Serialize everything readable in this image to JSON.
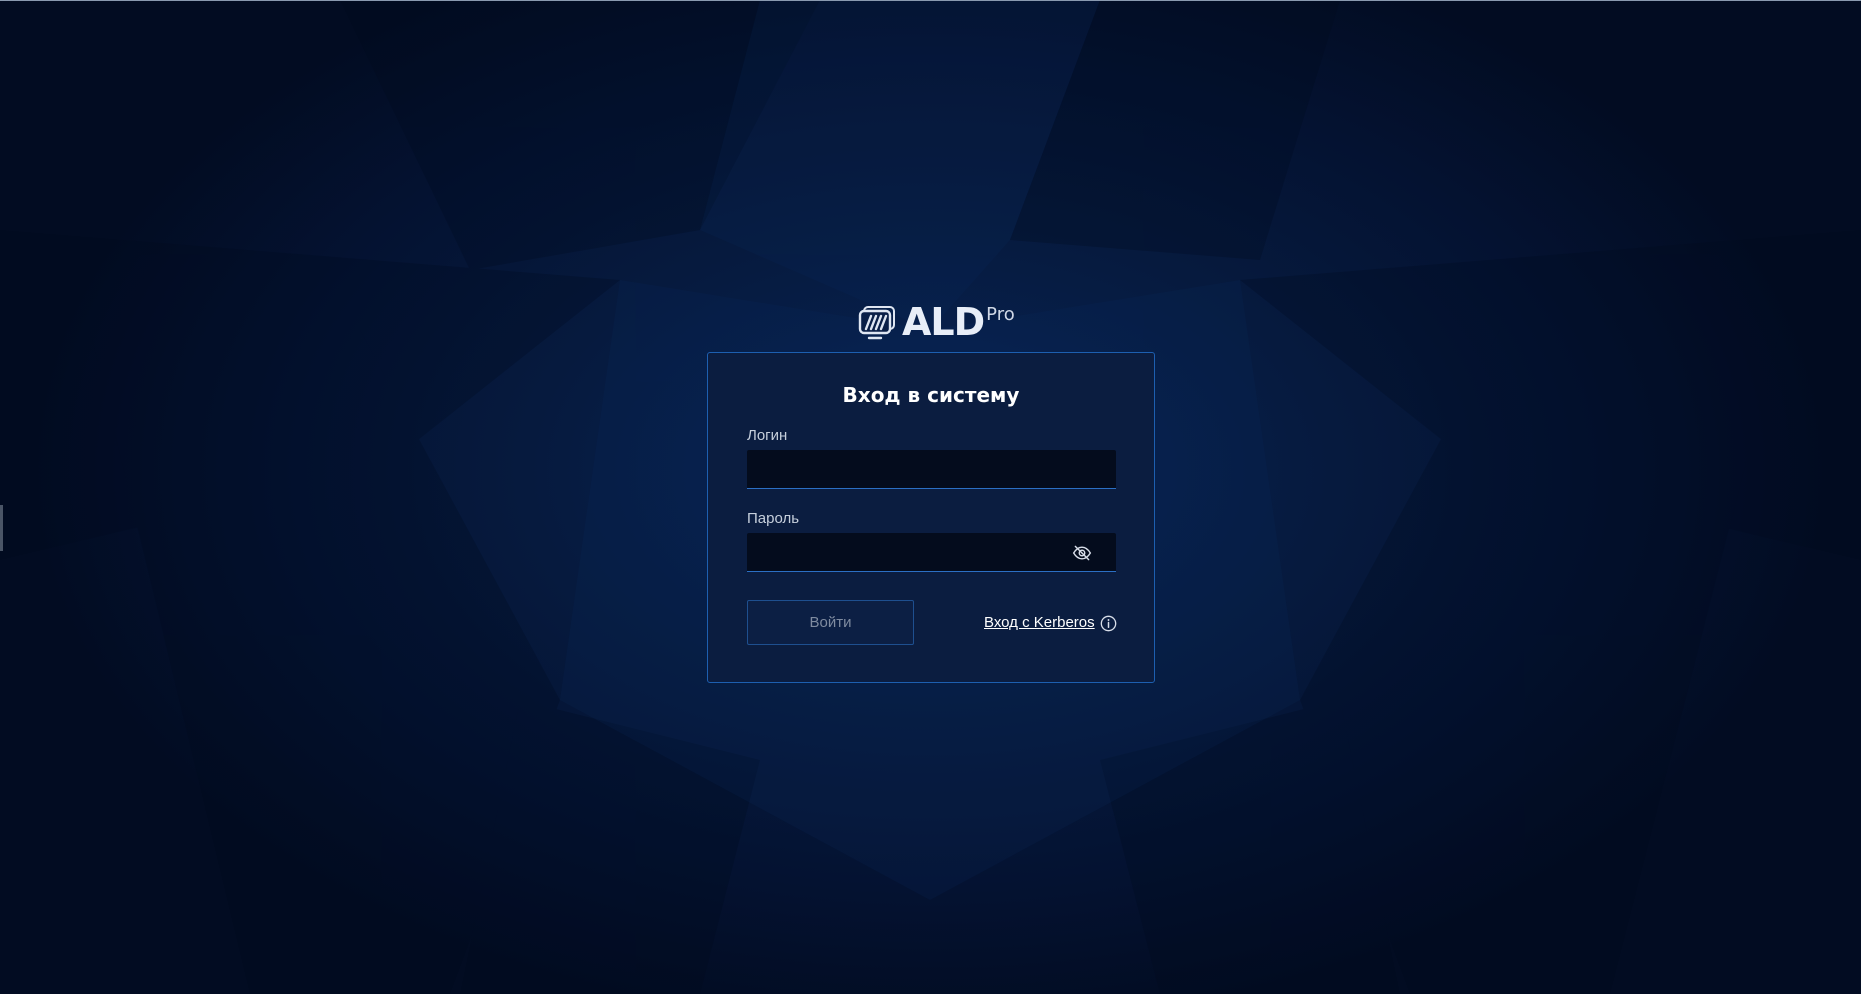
{
  "brand": {
    "logo_text": "ALD",
    "logo_superscript": "Pro",
    "logo_icon": "monitor-stack-icon"
  },
  "login_form": {
    "title": "Вход в систему",
    "login_label": "Логин",
    "login_value": "",
    "login_placeholder": "",
    "password_label": "Пароль",
    "password_value": "",
    "password_placeholder": "",
    "password_toggle_icon": "eye-off-icon",
    "submit_label": "Войти",
    "kerberos_link_label": "Вход с Kerberos",
    "kerberos_info_icon": "info-circle-icon"
  },
  "colors": {
    "background": "#061a3e",
    "card_background": "#0b1d40",
    "card_border": "#1d5fb0",
    "input_background": "#040c1d",
    "input_underline": "#2b6fc4",
    "disabled_button_text": "#7f8ba0"
  }
}
